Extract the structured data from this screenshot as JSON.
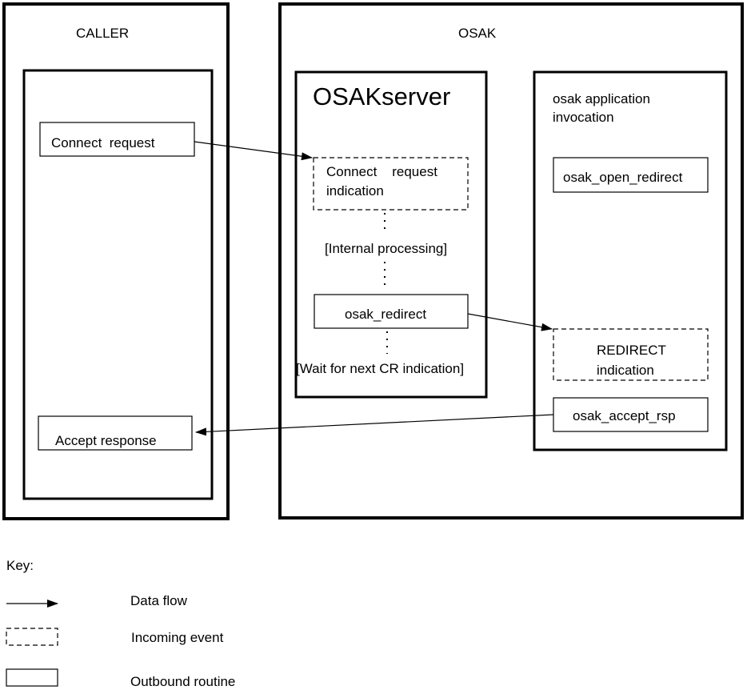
{
  "caller": {
    "title": "CALLER",
    "connect_request": "Connect  request",
    "accept_response": "Accept response"
  },
  "osak": {
    "title": "OSAK",
    "server": {
      "title": "OSAKserver",
      "connect_indication_line1": "Connect    request",
      "connect_indication_line2": "indication",
      "internal_processing": "[Internal processing]",
      "osak_redirect": "osak_redirect",
      "wait_next": "[Wait for next CR indication]"
    },
    "app": {
      "title_line1": "osak application",
      "title_line2": "invocation",
      "open_redirect": "osak_open_redirect",
      "redirect_indication_line1": "REDIRECT",
      "redirect_indication_line2": "indication",
      "accept_rsp": "osak_accept_rsp"
    }
  },
  "key": {
    "title": "Key:",
    "data_flow": "Data flow",
    "incoming_event": "Incoming event",
    "outbound_routine": "Outbound routine"
  }
}
